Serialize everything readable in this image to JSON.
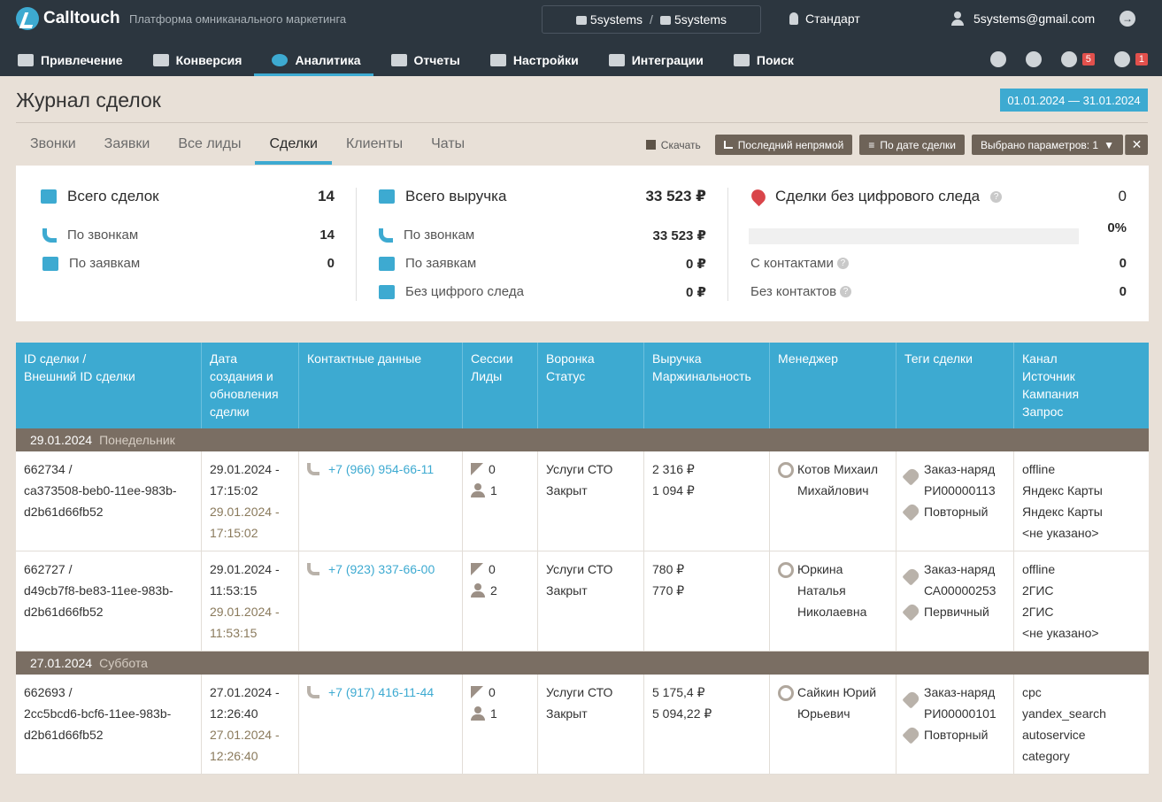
{
  "header": {
    "logo": "Calltouch",
    "tagline": "Платформа омниканального маркетинга",
    "account_from": "5systems",
    "account_sep": "/",
    "account_to": "5systems",
    "plan": "Стандарт",
    "user_email": "5systems@gmail.com"
  },
  "nav": {
    "items": [
      "Привлечение",
      "Конверсия",
      "Аналитика",
      "Отчеты",
      "Настройки",
      "Интеграции",
      "Поиск"
    ],
    "active_index": 2,
    "courses_badge": "5",
    "notifications_badge": "1"
  },
  "page": {
    "title": "Журнал сделок",
    "date_range": "01.01.2024  —  31.01.2024",
    "tabs": [
      "Звонки",
      "Заявки",
      "Все лиды",
      "Сделки",
      "Клиенты",
      "Чаты"
    ],
    "active_tab": 3,
    "download": "Скачать",
    "attribution": "Последний непрямой",
    "sort_by": "По дате сделки",
    "params": "Выбрано параметров: 1",
    "close": "✕"
  },
  "summary": {
    "deals": {
      "title": "Всего сделок",
      "total": "14",
      "by_calls_label": "По звонкам",
      "by_calls": "14",
      "by_requests_label": "По заявкам",
      "by_requests": "0"
    },
    "revenue": {
      "title": "Всего выручка",
      "total": "33 523 ₽",
      "by_calls_label": "По звонкам",
      "by_calls": "33 523 ₽",
      "by_requests_label": "По заявкам",
      "by_requests": "0 ₽",
      "no_trace_label": "Без цифрого следа",
      "no_trace": "0 ₽"
    },
    "untraced": {
      "title": "Сделки без цифрового следа",
      "total": "0",
      "percent_label": "0%",
      "percent": 0,
      "with_contacts_label": "С контактами",
      "with_contacts": "0",
      "without_contacts_label": "Без контактов",
      "without_contacts": "0"
    }
  },
  "table": {
    "headers": [
      [
        "ID сделки /",
        "Внешний ID сделки"
      ],
      [
        "Дата",
        "создания и",
        "обновления",
        "сделки"
      ],
      [
        "Контактные данные"
      ],
      [
        "Сессии",
        "Лиды"
      ],
      [
        "Воронка",
        "Статус"
      ],
      [
        "Выручка",
        "Маржинальность"
      ],
      [
        "Менеджер"
      ],
      [
        "Теги сделки"
      ],
      [
        "Канал",
        "Источник",
        "Кампания",
        "Запрос"
      ]
    ],
    "groups": [
      {
        "date": "29.01.2024",
        "weekday": "Понедельник",
        "rows": [
          {
            "id": [
              "662734 /",
              "ca373508-beb0-11ee-983b-",
              "d2b61d66fb52"
            ],
            "created": [
              "29.01.2024 -",
              "17:15:02"
            ],
            "updated": [
              "29.01.2024 -",
              "17:15:02"
            ],
            "phone": "+7 (966) 954-66-11",
            "sessions": "0",
            "leads": "1",
            "funnel": "Услуги СТО",
            "status": "Закрыт",
            "revenue": "2 316 ₽",
            "margin": "1 094 ₽",
            "manager": [
              "Котов Михаил",
              "Михайлович"
            ],
            "tags": [
              [
                "Заказ-наряд",
                "РИ00000113"
              ],
              [
                "Повторный"
              ]
            ],
            "channel": [
              "offline",
              "Яндекс Карты",
              "Яндекс Карты",
              "<не указано>"
            ]
          },
          {
            "id": [
              "662727 /",
              "d49cb7f8-be83-11ee-983b-",
              "d2b61d66fb52"
            ],
            "created": [
              "29.01.2024 -",
              "11:53:15"
            ],
            "updated": [
              "29.01.2024 -",
              "11:53:15"
            ],
            "phone": "+7 (923) 337-66-00",
            "sessions": "0",
            "leads": "2",
            "funnel": "Услуги СТО",
            "status": "Закрыт",
            "revenue": "780 ₽",
            "margin": "770 ₽",
            "manager": [
              "Юркина",
              "Наталья",
              "Николаевна"
            ],
            "tags": [
              [
                "Заказ-наряд",
                "СА00000253"
              ],
              [
                "Первичный"
              ]
            ],
            "channel": [
              "offline",
              "2ГИС",
              "2ГИС",
              "<не указано>"
            ]
          }
        ]
      },
      {
        "date": "27.01.2024",
        "weekday": "Суббота",
        "rows": [
          {
            "id": [
              "662693 /",
              "2cc5bcd6-bcf6-11ee-983b-",
              "d2b61d66fb52"
            ],
            "created": [
              "27.01.2024 -",
              "12:26:40"
            ],
            "updated": [
              "27.01.2024 -",
              "12:26:40"
            ],
            "phone": "+7 (917) 416-11-44",
            "sessions": "0",
            "leads": "1",
            "funnel": "Услуги СТО",
            "status": "Закрыт",
            "revenue": "5 175,4 ₽",
            "margin": "5 094,22 ₽",
            "manager": [
              "Сайкин Юрий",
              "Юрьевич"
            ],
            "tags": [
              [
                "Заказ-наряд",
                "РИ00000101"
              ],
              [
                "Повторный"
              ]
            ],
            "channel": [
              "cpc",
              "yandex_search",
              "autoservice",
              "category"
            ]
          }
        ]
      }
    ]
  },
  "colors": {
    "accent": "#3daad1",
    "header_bg": "#2c363f",
    "group_bg": "#7a6e63",
    "page_bg": "#e8e0d7"
  }
}
